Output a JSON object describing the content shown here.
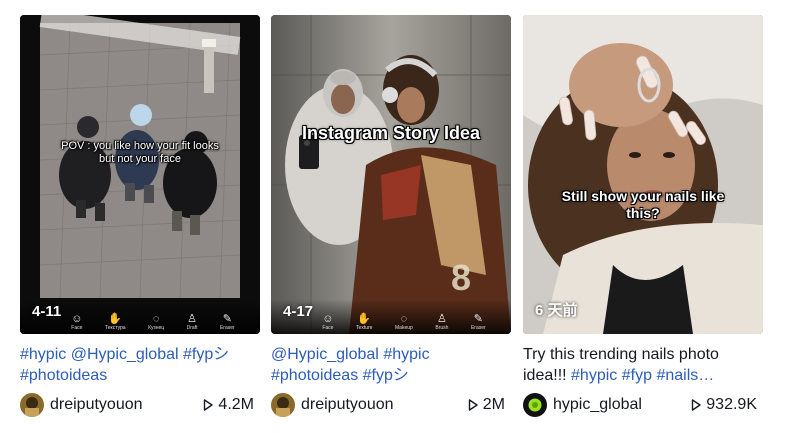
{
  "cards": [
    {
      "overlay_text": "POV : you like how your fit looks but not your face",
      "date": "4-11",
      "tools": [
        "Face",
        "Текстура",
        "Кузнец",
        "Draft",
        "Eraser"
      ],
      "desc": [
        {
          "text": "#hypic",
          "type": "tag"
        },
        {
          "text": " ",
          "type": "plain"
        },
        {
          "text": "@Hypic_global",
          "type": "tag"
        },
        {
          "text": " ",
          "type": "plain"
        },
        {
          "text": "#fypシ",
          "type": "tag"
        },
        {
          "text": " ",
          "type": "plain"
        },
        {
          "text": "#photoideas",
          "type": "tag"
        }
      ],
      "author": "dreiputyouon",
      "views": "4.2M",
      "avatar_color": "#8a6a2a"
    },
    {
      "overlay_text": "Instagram Story Idea",
      "date": "4-17",
      "tools": [
        "Face",
        "Texture",
        "Makeup",
        "Brush",
        "Eraser"
      ],
      "desc": [
        {
          "text": "@Hypic_global",
          "type": "tag"
        },
        {
          "text": " ",
          "type": "plain"
        },
        {
          "text": "#hypic",
          "type": "tag"
        },
        {
          "text": " ",
          "type": "plain"
        },
        {
          "text": "#photoideas",
          "type": "tag"
        },
        {
          "text": " ",
          "type": "plain"
        },
        {
          "text": "#fypシ",
          "type": "tag"
        }
      ],
      "author": "dreiputyouon",
      "views": "2M",
      "avatar_color": "#8a6a2a"
    },
    {
      "overlay_text": "Still show your nails like this?",
      "date": "6 天前",
      "tools": [],
      "desc": [
        {
          "text": "Try this trending nails photo idea!!! ",
          "type": "plain"
        },
        {
          "text": "#hypic",
          "type": "tag"
        },
        {
          "text": " ",
          "type": "plain"
        },
        {
          "text": "#fyp",
          "type": "tag"
        },
        {
          "text": " ",
          "type": "plain"
        },
        {
          "text": "#nails…",
          "type": "tag"
        }
      ],
      "author": "hypic_global",
      "views": "932.9K",
      "avatar_color": "#111111"
    }
  ],
  "colors": {
    "tag": "#2b5db9",
    "text": "#161823",
    "hypic_logo_green": "#9be21e"
  }
}
